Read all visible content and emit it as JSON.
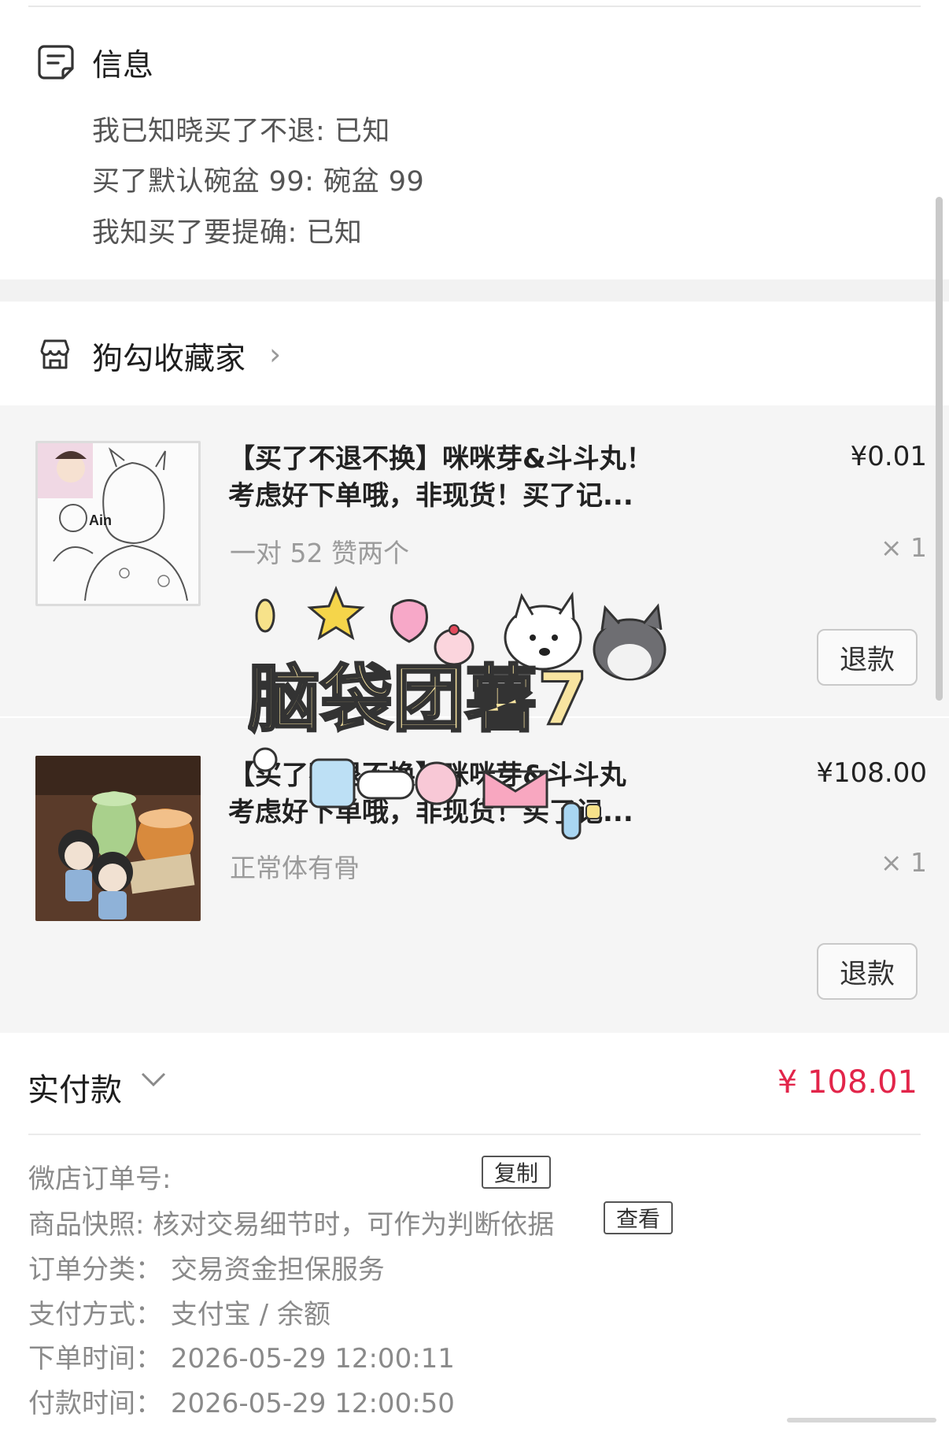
{
  "info": {
    "title": "信息",
    "lines": [
      "我已知晓买了不退: 已知",
      "买了默认碗盆 99: 碗盆 99",
      "我知买了要提确: 已知"
    ]
  },
  "shop": {
    "name": "狗勾收藏家"
  },
  "items": [
    {
      "title_line1": "【买了不退不换】咪咪芽&斗斗丸！",
      "title_line2": "考虑好下单哦，非现货！买了记...",
      "price": "¥0.01",
      "spec": "一对 52 赞两个",
      "qty": "× 1",
      "refund_label": "退款",
      "thumb_caption": "Ain"
    },
    {
      "title_line1": "【买了不退不换】咪咪芽&斗斗丸",
      "title_line2": "考虑好下单哦，非现货！买了记...",
      "price": "¥108.00",
      "spec": "正常体有骨",
      "qty": "× 1",
      "refund_label": "退款"
    }
  ],
  "sticker": {
    "text": "脑袋团薯7"
  },
  "paid": {
    "label": "实付款",
    "amount": "¥ 108.01"
  },
  "meta": {
    "order_no_label": "微店订单号:",
    "copy_label": "复制",
    "snapshot_label": "商品快照:",
    "snapshot_value": "核对交易细节时，可作为判断依据",
    "view_label": "查看",
    "category_label": "订单分类：",
    "category_value": "交易资金担保服务",
    "pay_method_label": "支付方式：",
    "pay_method_value": "支付宝 / 余额",
    "order_time_label": "下单时间：",
    "order_time_value": "2026-05-29 12:00:11",
    "pay_time_label": "付款时间：",
    "pay_time_value": "2026-05-29 12:00:50"
  },
  "colors": {
    "price_red": "#e2254a",
    "panel_bg": "#f5f5f5"
  }
}
